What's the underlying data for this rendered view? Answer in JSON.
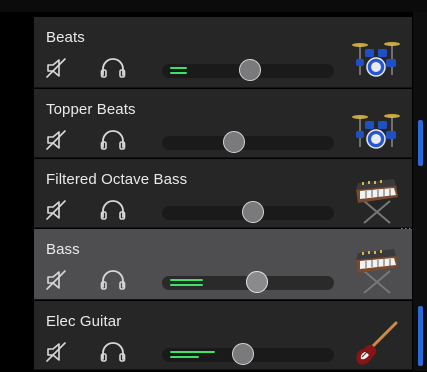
{
  "tracks": [
    {
      "name": "Beats",
      "selected": false,
      "volume_level": 0.51,
      "meter_bars": [
        0.1,
        0.1
      ],
      "instrument_icon": "drum-kit-icon"
    },
    {
      "name": "Topper Beats",
      "selected": false,
      "volume_level": 0.42,
      "meter_bars": [],
      "instrument_icon": "drum-kit-icon"
    },
    {
      "name": "Filtered Octave Bass",
      "selected": false,
      "volume_level": 0.53,
      "meter_bars": [],
      "instrument_icon": "synthesizer-icon"
    },
    {
      "name": "Bass",
      "selected": true,
      "volume_level": 0.55,
      "meter_bars": [
        0.19,
        0.19
      ],
      "instrument_icon": "synthesizer-icon"
    },
    {
      "name": "Elec Guitar",
      "selected": false,
      "volume_level": 0.47,
      "meter_bars": [
        0.26,
        0.17
      ],
      "instrument_icon": "electric-guitar-icon"
    }
  ],
  "colors": {
    "track_bg": "#262627",
    "selected_track_bg": "#4e4e50",
    "meter_green": "#3ee06a",
    "accent_blue": "#2a6ad8"
  }
}
